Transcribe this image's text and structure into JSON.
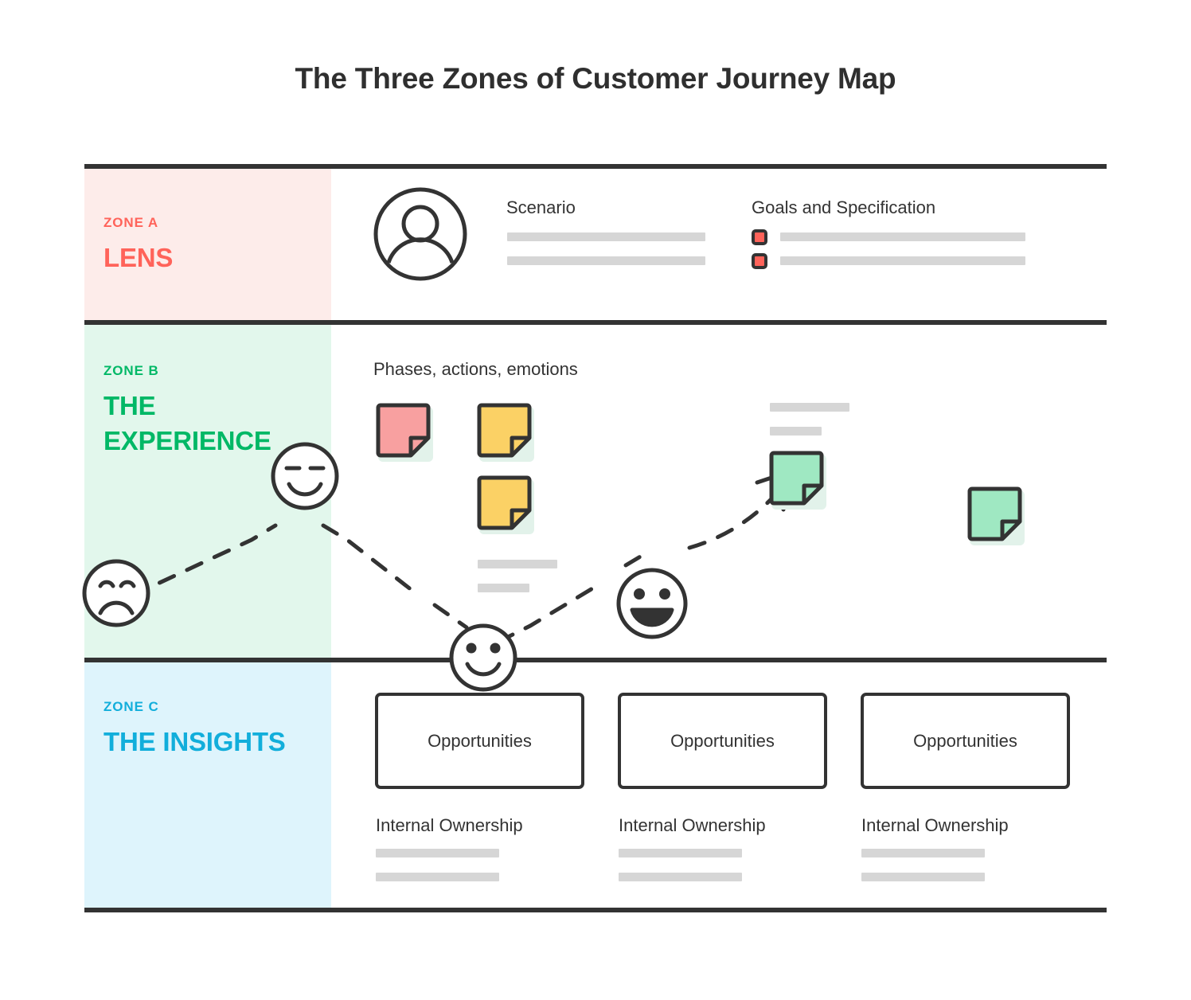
{
  "title": "The Three Zones of Customer Journey Map",
  "zones": [
    {
      "kicker": "ZONE A",
      "name": "LENS",
      "color": "#FF635A",
      "panel_bg": "#FDECEA"
    },
    {
      "kicker": "ZONE B",
      "name_line1": "THE",
      "name_line2": "EXPERIENCE",
      "color": "#00B866",
      "panel_bg": "#E2F7EC"
    },
    {
      "kicker": "ZONE C",
      "name": "THE INSIGHTS",
      "color": "#12AEDB",
      "panel_bg": "#DEF4FC"
    }
  ],
  "zone_a": {
    "avatar_icon": "person-avatar-icon",
    "scenario_label": "Scenario",
    "goals_label": "Goals and Specification",
    "checkbox_color": "#FF635A",
    "placeholder_bar_color": "#D6D6D6"
  },
  "zone_b": {
    "section_label": "Phases, actions, emotions",
    "notes": [
      {
        "id": "note-1",
        "color": "#F8A0A0"
      },
      {
        "id": "note-2",
        "color": "#FBD165"
      },
      {
        "id": "note-3",
        "color": "#FBD165"
      },
      {
        "id": "note-4",
        "color": "#9FE8C2"
      },
      {
        "id": "note-5",
        "color": "#9FE8C2"
      }
    ],
    "emotions": [
      {
        "id": "face-sad",
        "icon": "sad-face-icon",
        "mood": "sad"
      },
      {
        "id": "face-content",
        "icon": "content-face-icon",
        "mood": "content"
      },
      {
        "id": "face-happy",
        "icon": "happy-face-icon",
        "mood": "happy"
      },
      {
        "id": "face-delighted",
        "icon": "delighted-face-icon",
        "mood": "delighted"
      }
    ],
    "curve_style": "dashed",
    "curve_end_icon": "arrow-up-right-icon",
    "line_color": "#333333"
  },
  "zone_c": {
    "columns": [
      {
        "opportunity_label": "Opportunities",
        "ownership_label": "Internal Ownership"
      },
      {
        "opportunity_label": "Opportunities",
        "ownership_label": "Internal Ownership"
      },
      {
        "opportunity_label": "Opportunities",
        "ownership_label": "Internal Ownership"
      }
    ]
  }
}
